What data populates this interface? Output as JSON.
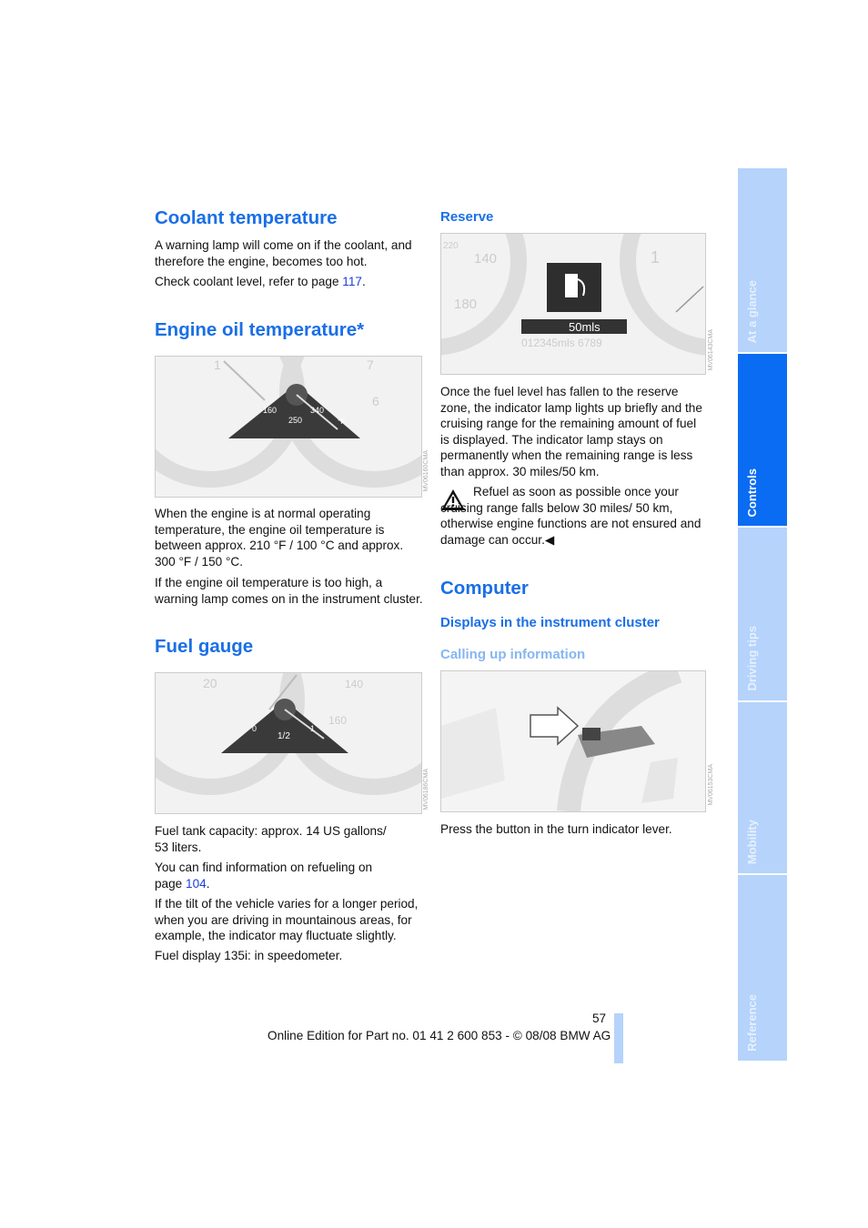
{
  "left": {
    "coolant": {
      "title": "Coolant temperature",
      "p1": "A warning lamp will come on if the coolant, and therefore the engine, becomes too hot.",
      "p2_prefix": "Check coolant level, refer to page ",
      "p2_link": "117",
      "p2_suffix": "."
    },
    "oil": {
      "title": "Engine oil temperature*",
      "figure_labels": [
        "160",
        "250",
        "340",
        "°F",
        "7",
        "6",
        "1"
      ],
      "figure_code": "MV06160CMA",
      "p1": "When the engine is at normal operating temperature, the engine oil temperature is between approx. 210 °F / 100 °C and approx. 300 °F / 150 °C.",
      "p2": "If the engine oil temperature is too high, a warning lamp comes on in the instrument cluster."
    },
    "fuel": {
      "title": "Fuel gauge",
      "figure_labels": [
        "0",
        "1/2",
        "1",
        "20",
        "140",
        "160"
      ],
      "figure_code": "MV06186CMA",
      "p1": "Fuel tank capacity: approx. 14 US gallons/ 53 liters.",
      "p2_prefix": "You can find information on refueling on page ",
      "p2_link": "104",
      "p2_suffix": ".",
      "p3": "If the tilt of the vehicle varies for a longer period, when you are driving in mountainous areas, for example, the indicator may fluctuate slightly.",
      "p4": "Fuel display 135i: in speedometer."
    }
  },
  "right": {
    "reserve": {
      "title": "Reserve",
      "figure_range": "50mls",
      "figure_odometer": "012345mls 6789",
      "figure_labels": [
        "140",
        "180",
        "220",
        "1"
      ],
      "figure_code": "MV06143CMA",
      "p1": "Once the fuel level has fallen to the reserve zone, the indicator lamp lights up briefly and the cruising range for the remaining amount of fuel is displayed. The indicator lamp stays on permanently when the remaining range is less than approx. 30 miles/50 km.",
      "warning": "Refuel as soon as possible once your cruising range falls below 30 miles/ 50 km, otherwise engine functions are not ensured and damage can occur.",
      "end_mark": "◀"
    },
    "computer": {
      "title": "Computer",
      "subtitle": "Displays in the instrument cluster",
      "subsubtitle": "Calling up information",
      "figure_code": "MV06153CMA",
      "p1": "Press the button in the turn indicator lever."
    }
  },
  "footer": {
    "page_number": "57",
    "edition": "Online Edition for Part no. 01 41 2 600 853 - © 08/08 BMW AG"
  },
  "side_tabs": [
    {
      "label": "At a glance",
      "active": false
    },
    {
      "label": "Controls",
      "active": true
    },
    {
      "label": "Driving tips",
      "active": false
    },
    {
      "label": "Mobility",
      "active": false
    },
    {
      "label": "Reference",
      "active": false
    }
  ],
  "colors": {
    "heading": "#1a6fe6",
    "tab_active": "#0a6cf2",
    "tab_inactive": "#b5d3fb",
    "link": "#1a3fd8"
  }
}
